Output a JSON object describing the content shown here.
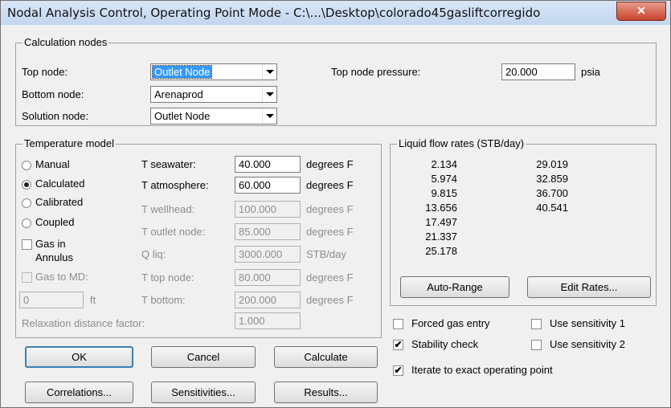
{
  "window": {
    "title": "Nodal Analysis Control, Operating Point Mode - C:\\...\\Desktop\\colorado45gasliftcorregido",
    "close_glyph": "✕"
  },
  "calc_nodes": {
    "title": "Calculation nodes",
    "top_label": "Top node:",
    "top_value": "Outlet Node",
    "bottom_label": "Bottom node:",
    "bottom_value": "Arenaprod",
    "solution_label": "Solution node:",
    "solution_value": "Outlet Node",
    "pressure_label": "Top node pressure:",
    "pressure_value": "20.000",
    "pressure_unit": "psia"
  },
  "temp_model": {
    "title": "Temperature model",
    "options": [
      "Manual",
      "Calculated",
      "Calibrated",
      "Coupled"
    ],
    "selected": "Calculated",
    "gas_annulus_1": "Gas in",
    "gas_annulus_2": "Annulus",
    "gas_to_md": "Gas to MD:",
    "md_value": "0",
    "md_unit": "ft",
    "relax_label": "Relaxation distance factor:",
    "relax_value": "1.000",
    "rows": [
      {
        "label": "T seawater:",
        "value": "40.000",
        "unit": "degrees F"
      },
      {
        "label": "T atmosphere:",
        "value": "60.000",
        "unit": "degrees F"
      },
      {
        "label": "T wellhead:",
        "value": "100.000",
        "unit": "degrees F"
      },
      {
        "label": "T outlet node:",
        "value": "85.000",
        "unit": "degrees F"
      },
      {
        "label": "Q liq:",
        "value": "3000.000",
        "unit": "STB/day"
      },
      {
        "label": "T top node:",
        "value": "80.000",
        "unit": "degrees F"
      },
      {
        "label": "T bottom:",
        "value": "200.000",
        "unit": "degrees F"
      }
    ]
  },
  "flow_rates": {
    "title": "Liquid flow rates (STB/day)",
    "col1": [
      "2.134",
      "5.974",
      "9.815",
      "13.656",
      "17.497",
      "21.337",
      "25.178"
    ],
    "col2": [
      "29.019",
      "32.859",
      "36.700",
      "40.541"
    ],
    "auto_range": "Auto-Range",
    "edit_rates": "Edit Rates..."
  },
  "options": {
    "forced_gas": "Forced gas entry",
    "use_sens1": "Use sensitivity 1",
    "stability": "Stability check",
    "use_sens2": "Use sensitivity 2",
    "iterate": "Iterate to exact operating point",
    "checkmark": "✔"
  },
  "buttons": {
    "ok": "OK",
    "cancel": "Cancel",
    "calculate": "Calculate",
    "correlations": "Correlations...",
    "sensitivities": "Sensitivities...",
    "results": "Results..."
  }
}
